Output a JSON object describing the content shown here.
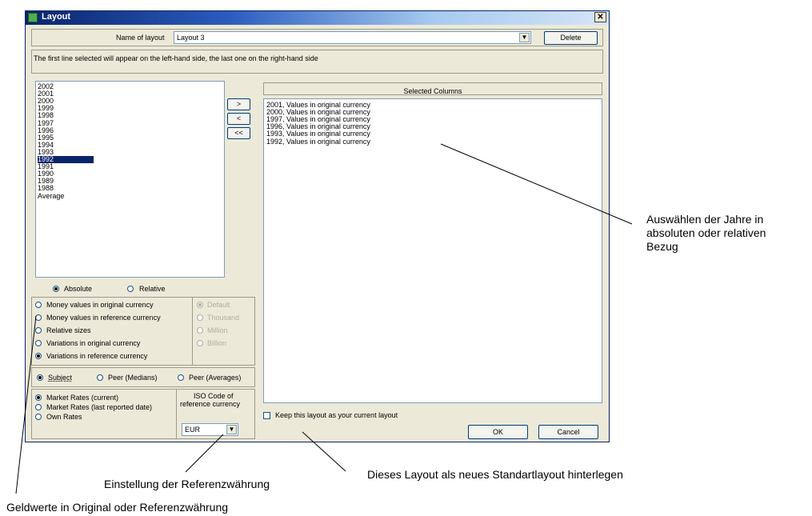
{
  "window": {
    "title": "Layout",
    "close_glyph": "✕"
  },
  "layout_name": {
    "label": "Name of layout",
    "value": "Layout 3",
    "delete_label": "Delete"
  },
  "info_text": "The first line selected will appear on the left-hand side, the last one on the right-hand side",
  "years": [
    "2002",
    "2001",
    "2000",
    "1999",
    "1998",
    "1997",
    "1996",
    "1995",
    "1994",
    "1993",
    "1992",
    "1991",
    "1990",
    "1989",
    "1988",
    "Average"
  ],
  "selected_year": "1992",
  "move_buttons": {
    "add": ">",
    "remove": "<",
    "remove_all": "<<"
  },
  "selected_columns": {
    "header": "Selected Columns",
    "items": [
      "2001, Values in original currency",
      "2000, Values in original currency",
      "1997, Values in original currency",
      "1996, Values in original currency",
      "1993, Values in original currency",
      "1992, Values in original currency"
    ]
  },
  "mode": {
    "absolute": "Absolute",
    "relative": "Relative",
    "selected": "Absolute"
  },
  "value_types": [
    "Money values in original currency",
    "Money values in reference currency",
    "Relative sizes",
    "Variations in original currency",
    "Variations in reference currency"
  ],
  "value_type_selected": "Variations in reference currency",
  "scales": [
    "Default",
    "Thousand",
    "Million",
    "Billion"
  ],
  "scale_selected": "Default",
  "comparison": {
    "subject": "Subject",
    "peer_medians": "Peer (Medians)",
    "peer_averages": "Peer (Averages)",
    "selected": "Subject"
  },
  "rates": [
    "Market Rates (current)",
    "Market Rates (last reported date)",
    "Own Rates"
  ],
  "rate_selected": "Market Rates (current)",
  "iso": {
    "label_line1": "ISO Code of",
    "label_line2": "reference currency",
    "value": "EUR"
  },
  "keep_layout_label": "Keep this layout as your current layout",
  "ok_label": "OK",
  "cancel_label": "Cancel",
  "annotations": {
    "years": [
      "Auswählen der Jahre in",
      "absoluten oder relativen",
      "Bezug"
    ],
    "keep_layout": "Dieses Layout als neues Standartlayout hinterlegen",
    "reference_currency": "Einstellung der Referenzwährung",
    "money_values": "Geldwerte in Original oder Referenzwährung"
  }
}
